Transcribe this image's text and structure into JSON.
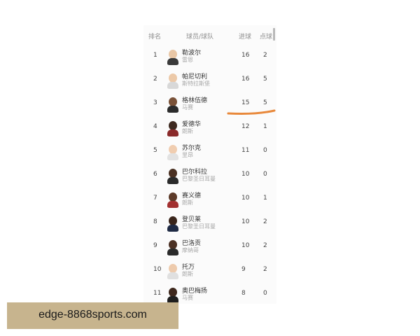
{
  "table": {
    "headers": {
      "rank": "排名",
      "player_team": "球员/球队",
      "goals": "进球",
      "penalties": "点球"
    },
    "rows": [
      {
        "rank": "1",
        "name": "勒波尔",
        "team": "雷恩",
        "goals": "16",
        "penalties": "2",
        "skin": "#e9c7a6",
        "shirt": "#3a3a3a"
      },
      {
        "rank": "2",
        "name": "帕尼切利",
        "team": "斯特拉斯堡",
        "goals": "16",
        "penalties": "5",
        "skin": "#ecc9a8",
        "shirt": "#d8d8d8"
      },
      {
        "rank": "3",
        "name": "格林伍德",
        "team": "马赛",
        "goals": "15",
        "penalties": "5",
        "skin": "#7a5238",
        "shirt": "#2b2b2b"
      },
      {
        "rank": "4",
        "name": "爱德华",
        "team": "朗斯",
        "goals": "12",
        "penalties": "1",
        "skin": "#3e2a20",
        "shirt": "#8a2a2a"
      },
      {
        "rank": "5",
        "name": "苏尔克",
        "team": "里昂",
        "goals": "11",
        "penalties": "0",
        "skin": "#f0cdb0",
        "shirt": "#e2e2e2"
      },
      {
        "rank": "6",
        "name": "巴尔科拉",
        "team": "巴黎圣日耳曼",
        "goals": "10",
        "penalties": "0",
        "skin": "#4a3022",
        "shirt": "#2a2a2a"
      },
      {
        "rank": "7",
        "name": "赛义德",
        "team": "朗斯",
        "goals": "10",
        "penalties": "1",
        "skin": "#5c3a28",
        "shirt": "#a23030"
      },
      {
        "rank": "8",
        "name": "登贝莱",
        "team": "巴黎圣日耳曼",
        "goals": "10",
        "penalties": "2",
        "skin": "#3a251b",
        "shirt": "#1f2a44"
      },
      {
        "rank": "9",
        "name": "巴洛贡",
        "team": "摩纳哥",
        "goals": "10",
        "penalties": "2",
        "skin": "#4b3124",
        "shirt": "#2a2a2a"
      },
      {
        "rank": "10",
        "name": "托万",
        "team": "朗斯",
        "goals": "9",
        "penalties": "2",
        "skin": "#eecbad",
        "shirt": "#e0e0e0"
      },
      {
        "rank": "11",
        "name": "奥巴梅扬",
        "team": "马赛",
        "goals": "8",
        "penalties": "0",
        "skin": "#3e281d",
        "shirt": "#1e1e1e"
      }
    ]
  },
  "annotation": {
    "color": "#e8883a"
  },
  "banner": {
    "text": "edge-8868sports.com",
    "color": "#c7b48e"
  }
}
